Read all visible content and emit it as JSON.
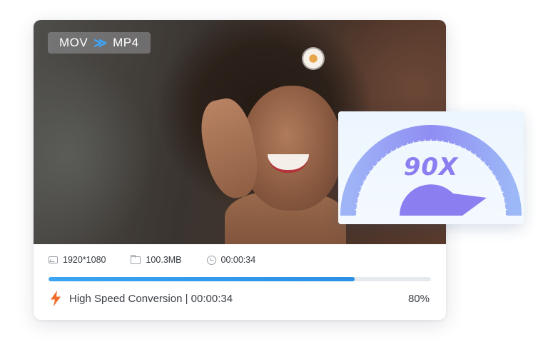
{
  "video": {
    "source_format": "MOV",
    "target_format": "MP4",
    "arrow_glyph": "≫"
  },
  "meta": {
    "resolution": "1920*1080",
    "size": "100.3MB",
    "duration": "00:00:34"
  },
  "progress": {
    "fraction": 0.8,
    "label": "High Speed Conversion | 00:00:34",
    "percent_text": "80%"
  },
  "gauge": {
    "value_text": "90X"
  },
  "colors": {
    "accent_blue": "#2b8fe6",
    "gauge_purple": "#8b7ef0",
    "bolt_orange": "#f26b2a"
  },
  "icons": {
    "resolution": "image-icon",
    "size": "folder-icon",
    "duration": "clock-icon",
    "status": "lightning-icon"
  }
}
